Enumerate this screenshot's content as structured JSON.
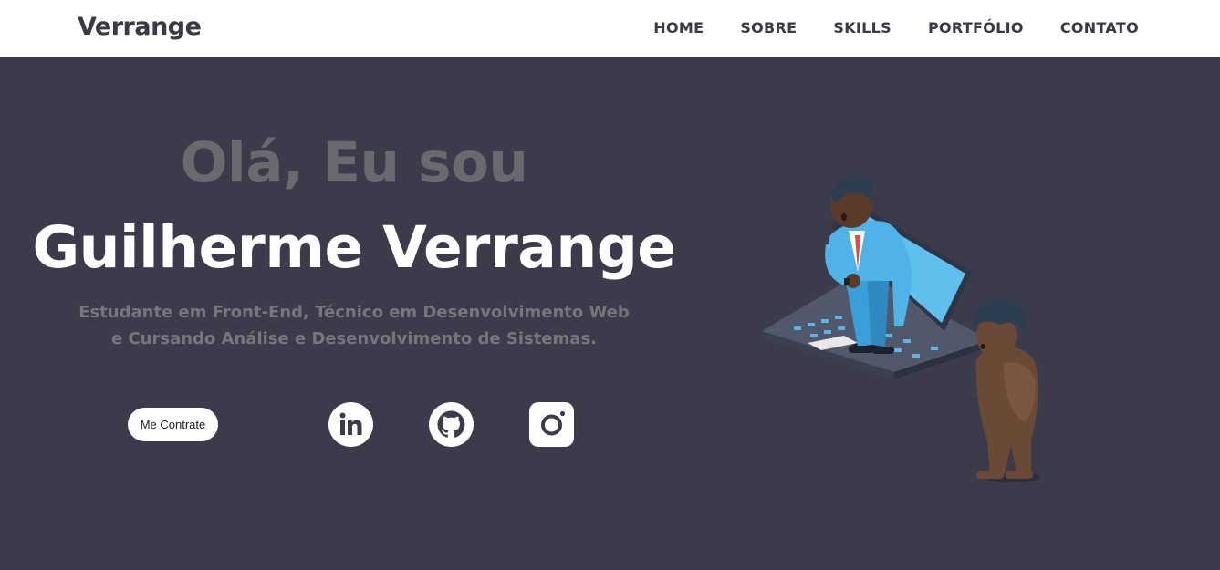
{
  "header": {
    "logo": "Verrange",
    "nav": [
      "HOME",
      "SOBRE",
      "SKILLS",
      "PORTFÓLIO",
      "CONTATO"
    ]
  },
  "hero": {
    "greeting": "Olá, Eu sou",
    "name": "Guilherme Verrange",
    "subtitle_line1": "Estudante em Front-End, Técnico em Desenvolvimento Web",
    "subtitle_line2": "e Cursando Análise e Desenvolvimento de Sistemas.",
    "cta_label": "Me Contrate",
    "socials": [
      "linkedin-icon",
      "github-icon",
      "instagram-icon"
    ]
  },
  "colors": {
    "background": "#3b3b4c",
    "navbar": "#ffffff",
    "text_dark": "#393a45",
    "greeting": "#6a6a6e",
    "subtitle": "#76767c"
  }
}
